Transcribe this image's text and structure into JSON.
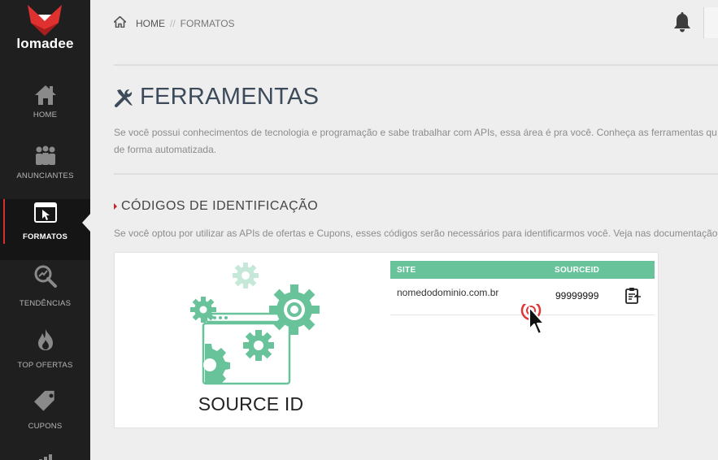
{
  "brand": {
    "name": "lomadee"
  },
  "sidebar": {
    "items": [
      {
        "label": "HOME",
        "icon": "home-icon",
        "active": false
      },
      {
        "label": "ANUNCIANTES",
        "icon": "people-icon",
        "active": false
      },
      {
        "label": "FORMATOS",
        "icon": "window-cursor-icon",
        "active": true
      },
      {
        "label": "TENDÊNCIAS",
        "icon": "trend-search-icon",
        "active": false
      },
      {
        "label": "TOP OFERTAS",
        "icon": "flame-icon",
        "active": false
      },
      {
        "label": "CUPONS",
        "icon": "tag-icon",
        "active": false
      }
    ]
  },
  "breadcrumb": {
    "home": "HOME",
    "separator": "//",
    "current": "FORMATOS"
  },
  "header": {
    "title": "FERRAMENTAS"
  },
  "intro": {
    "line1": "Se você possui conhecimentos de tecnologia e programação e sabe trabalhar com APIs, essa área é pra você. Conheça as ferramentas qu",
    "line2": "de forma automatizada."
  },
  "section": {
    "title": "CÓDIGOS DE IDENTIFICAÇÃO",
    "description": "Se você optou por utilizar as APIs de ofertas e Cupons, esses códigos serão necessários para identificarmos você. Veja nas documentação"
  },
  "card": {
    "title": "SOURCE ID",
    "table": {
      "headers": [
        "SITE",
        "SOURCEID"
      ],
      "rows": [
        {
          "site": "nomedodominio.com.br",
          "sourceid": "99999999"
        }
      ]
    }
  },
  "colors": {
    "accent_green": "#68c39b",
    "accent_red": "#c0282a",
    "sidebar_bg": "#1f1f1f"
  }
}
